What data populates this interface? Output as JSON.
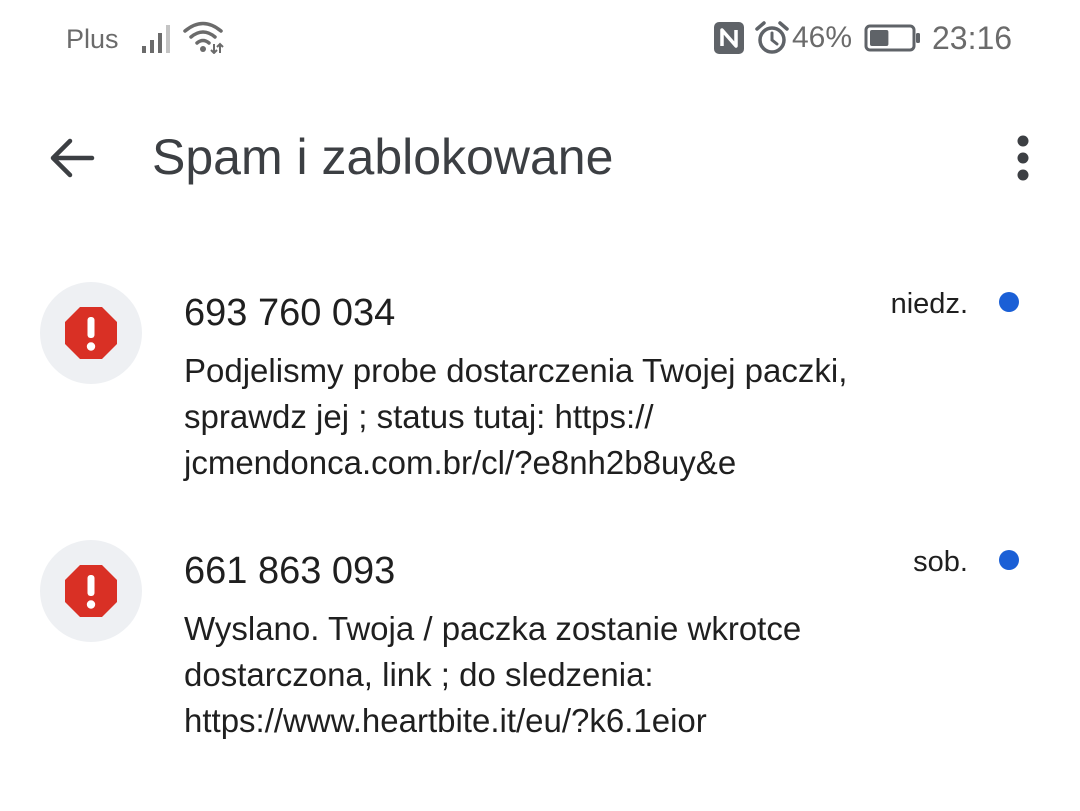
{
  "status_bar": {
    "carrier": "Plus",
    "battery_percent": "46%",
    "battery_level": 0.46,
    "time": "23:16",
    "icons": [
      "signal-icon",
      "wifi-icon",
      "nfc-icon",
      "alarm-icon",
      "battery-icon"
    ]
  },
  "app_bar": {
    "title": "Spam i zablokowane",
    "back_icon": "arrow-back-icon",
    "menu_icon": "more-vert-icon"
  },
  "conversations": [
    {
      "sender": "693 760 034",
      "snippet": "Podjelismy probe dostarczenia Twojej paczki, sprawdz jej ; status tutaj: https:// jcmendonca.com.br/cl/?e8nh2b8uy&e",
      "timestamp": "niedz.",
      "unread": true,
      "icon": "spam-warning-icon"
    },
    {
      "sender": "661 863 093",
      "snippet": "Wyslano. Twoja / paczka zostanie wkrotce dostarczona, link ; do sledzenia: https://www.heartbite.it/eu/?k6.1eior",
      "timestamp": "sob.",
      "unread": true,
      "icon": "spam-warning-icon"
    }
  ],
  "colors": {
    "spam_red": "#d93025",
    "unread_blue": "#1a5fd6",
    "avatar_bg": "#eef0f3",
    "status_gray": "#6b6b6b",
    "title_gray": "#3c3f43"
  }
}
